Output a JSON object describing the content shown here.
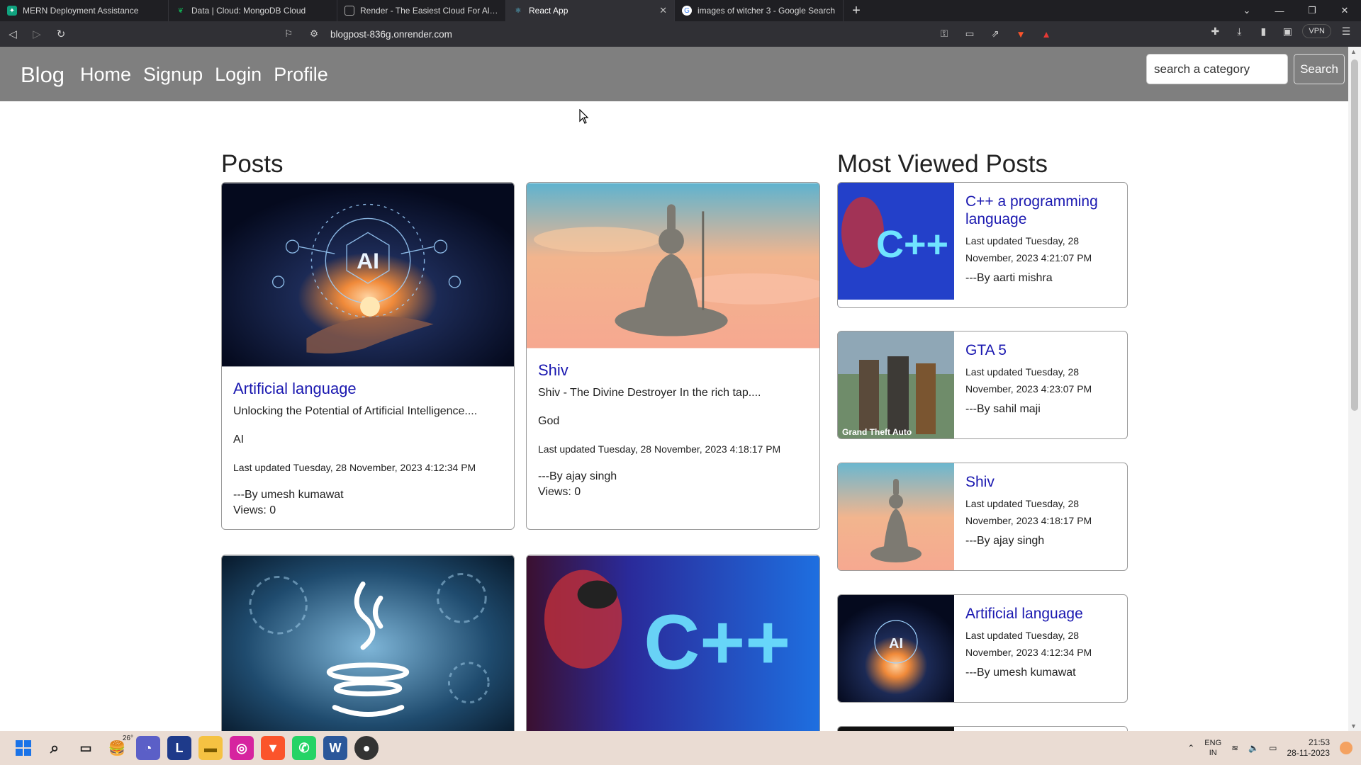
{
  "browser": {
    "tabs": [
      {
        "title": "MERN Deployment Assistance",
        "icon": "chatgpt-icon",
        "color": "#10a37f"
      },
      {
        "title": "Data | Cloud: MongoDB Cloud",
        "icon": "mongodb-leaf-icon",
        "color": "#13aa52"
      },
      {
        "title": "Render - The Easiest Cloud For All You",
        "icon": "render-icon",
        "color": "#5f5f66"
      },
      {
        "title": "React App",
        "icon": "react-icon",
        "color": "#61dafb",
        "active": true
      },
      {
        "title": "images of witcher 3 - Google Search",
        "icon": "google-icon",
        "color": "#4285f4"
      }
    ],
    "new_tab": "+",
    "url": "blogpost-836g.onrender.com",
    "vpn_label": "VPN"
  },
  "nav": {
    "brand": "Blog",
    "links": [
      "Home",
      "Signup",
      "Login",
      "Profile"
    ],
    "search_placeholder": "search a category",
    "search_button": "Search"
  },
  "posts": {
    "heading": "Posts",
    "items": [
      {
        "title": "Artificial language",
        "excerpt": "Unlocking the Potential of Artificial Intelligence....",
        "category": "AI",
        "updated": "Last updated Tuesday, 28 November, 2023 4:12:34 PM",
        "author": "---By umesh kumawat",
        "views": "Views: 0",
        "image": "ai"
      },
      {
        "title": "Shiv",
        "excerpt": "Shiv - The Divine Destroyer In the rich tap....",
        "category": "God",
        "updated": "Last updated Tuesday, 28 November, 2023 4:18:17 PM",
        "author": "---By ajay singh",
        "views": "Views: 0",
        "image": "shiv"
      },
      {
        "image": "java"
      },
      {
        "image": "cpp"
      }
    ]
  },
  "most_viewed": {
    "heading": "Most Viewed Posts",
    "items": [
      {
        "title": "C++ a programming language",
        "updated": "Last updated Tuesday, 28 November, 2023 4:21:07 PM",
        "author": "---By aarti mishra",
        "image": "cpp"
      },
      {
        "title": "GTA 5",
        "updated": "Last updated Tuesday, 28 November, 2023 4:23:07 PM",
        "author": "---By sahil maji",
        "image": "gta"
      },
      {
        "title": "Shiv",
        "updated": "Last updated Tuesday, 28 November, 2023 4:18:17 PM",
        "author": "---By ajay singh",
        "image": "shiv"
      },
      {
        "title": "Artificial language",
        "updated": "Last updated Tuesday, 28 November, 2023 4:12:34 PM",
        "author": "---By umesh kumawat",
        "image": "ai"
      }
    ]
  },
  "taskbar": {
    "weather": "26°",
    "lang_top": "ENG",
    "lang_bottom": "IN",
    "time": "21:53",
    "date": "28-11-2023"
  }
}
